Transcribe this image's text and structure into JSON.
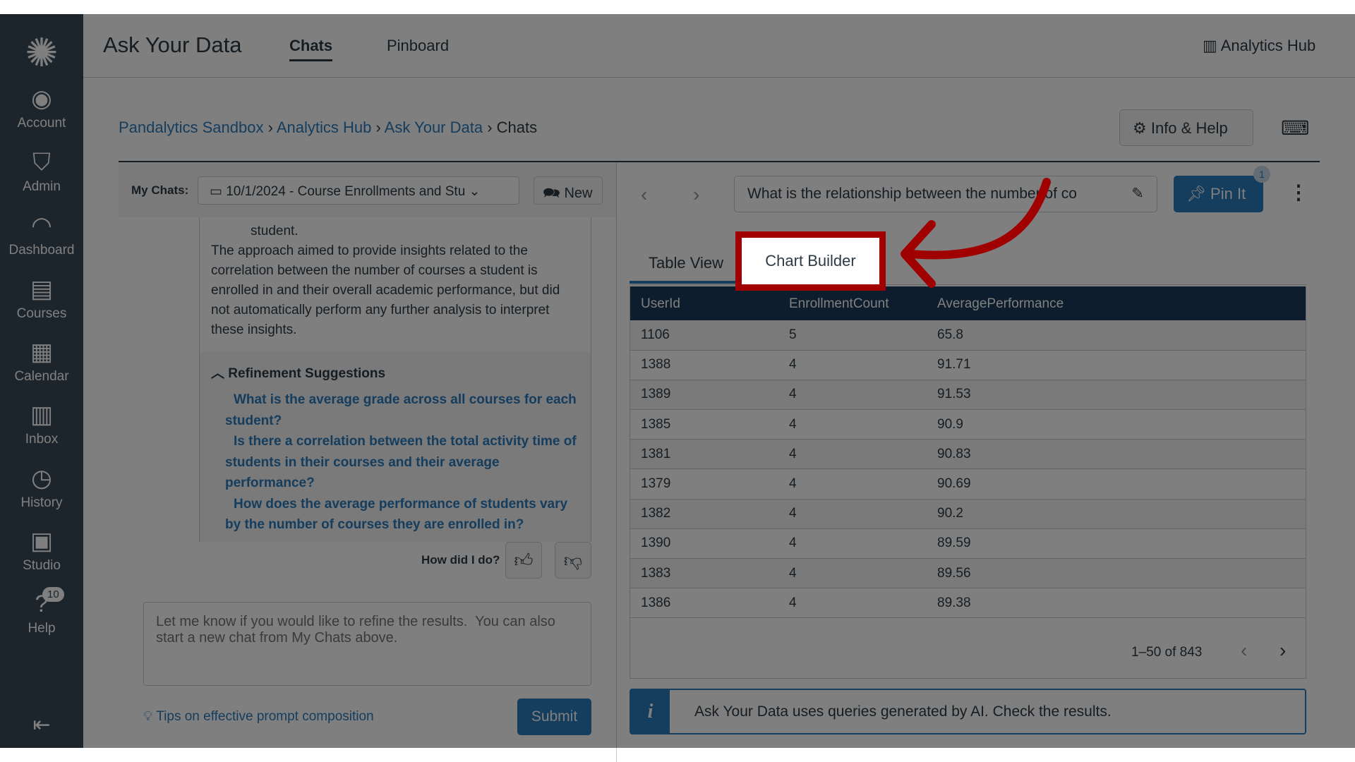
{
  "header": {
    "title": "Ask Your Data",
    "tabs": [
      "Chats",
      "Pinboard"
    ],
    "analytics_hub": "Analytics Hub"
  },
  "sidebar": {
    "items": [
      {
        "label": "Account",
        "icon": "account-icon"
      },
      {
        "label": "Admin",
        "icon": "admin-icon"
      },
      {
        "label": "Dashboard",
        "icon": "dashboard-icon"
      },
      {
        "label": "Courses",
        "icon": "courses-icon"
      },
      {
        "label": "Calendar",
        "icon": "calendar-icon"
      },
      {
        "label": "Inbox",
        "icon": "inbox-icon"
      },
      {
        "label": "History",
        "icon": "history-icon"
      },
      {
        "label": "Studio",
        "icon": "studio-icon"
      },
      {
        "label": "Help",
        "icon": "help-icon",
        "badge": "10"
      }
    ]
  },
  "breadcrumb": [
    "Pandalytics Sandbox",
    "Analytics Hub",
    "Ask Your Data",
    "Chats"
  ],
  "info_help": "Info & Help",
  "chats": {
    "label": "My Chats:",
    "selected": "10/1/2024 - Course Enrollments and Stu",
    "new": "New"
  },
  "message": {
    "fragment": "student.",
    "body": "The approach aimed to provide insights related to the correlation between the number of courses a student is enrolled in and their overall academic performance, but did not automatically perform any further analysis to interpret these insights.",
    "refinement_title": "Refinement Suggestions",
    "suggestions": [
      "What is the average grade across all courses for each student?",
      "Is there a correlation between the total activity time of students in their courses and their average performance?",
      "How does the average performance of students vary by the number of courses they are enrolled in?"
    ]
  },
  "feedback": {
    "label": "How did I do?"
  },
  "composer": {
    "placeholder": "Let me know if you would like to refine the results.  You can also start a new chat from My Chats above.",
    "tips": "Tips on effective prompt composition",
    "submit": "Submit"
  },
  "query": {
    "value": "What is the relationship between the number of co",
    "pin": "Pin It",
    "pin_badge": "1"
  },
  "result_tabs": [
    "Table View",
    "Chart Builder"
  ],
  "table": {
    "columns": [
      "UserId",
      "EnrollmentCount",
      "AveragePerformance"
    ],
    "rows": [
      [
        "1106",
        "5",
        "65.8"
      ],
      [
        "1388",
        "4",
        "91.71"
      ],
      [
        "1389",
        "4",
        "91.53"
      ],
      [
        "1385",
        "4",
        "90.9"
      ],
      [
        "1381",
        "4",
        "90.83"
      ],
      [
        "1379",
        "4",
        "90.69"
      ],
      [
        "1382",
        "4",
        "90.2"
      ],
      [
        "1390",
        "4",
        "89.59"
      ],
      [
        "1383",
        "4",
        "89.56"
      ],
      [
        "1386",
        "4",
        "89.38"
      ]
    ],
    "pagination": "1–50 of 843"
  },
  "banner": "Ask Your Data uses queries generated by AI. Check the results.",
  "colors": {
    "brand": "#2b7abc",
    "header": "#1b3a5c",
    "annotation": "#a00000"
  }
}
